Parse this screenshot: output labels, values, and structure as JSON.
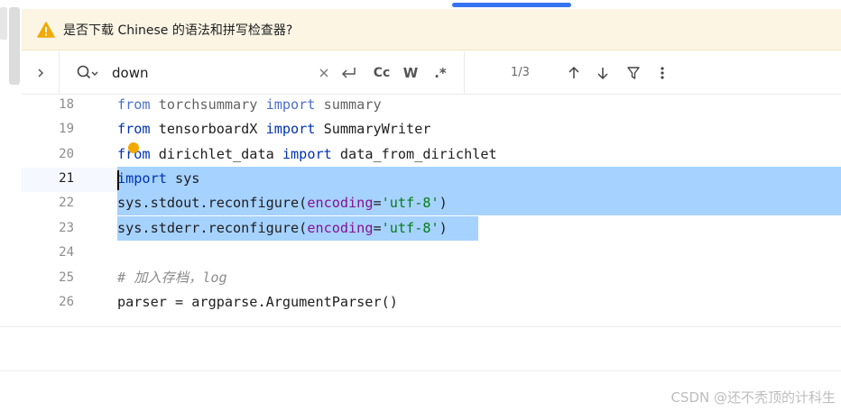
{
  "notice": {
    "icon": "warning-icon",
    "text": "是否下载 Chinese 的语法和拼写检查器?",
    "accent_color": "#f2a900"
  },
  "search": {
    "query": "down",
    "match_count": "1/3",
    "options": {
      "case_label": "Cc",
      "word_label": "W",
      "regex_label": ".*"
    }
  },
  "editor": {
    "lines": [
      {
        "number": "18",
        "text": "from torchsummary import summary"
      },
      {
        "number": "19",
        "text": "from tensorboardX import SummaryWriter"
      },
      {
        "number": "20",
        "text": "from dirichlet_data import data_from_dirichlet"
      },
      {
        "number": "21",
        "text": "import sys"
      },
      {
        "number": "22",
        "text": "sys.stdout.reconfigure(encoding='utf-8')"
      },
      {
        "number": "23",
        "text": "sys.stderr.reconfigure(encoding='utf-8')"
      },
      {
        "number": "24",
        "text": ""
      },
      {
        "number": "25",
        "text": "# 加入存档，log"
      },
      {
        "number": "26",
        "text": "parser = argparse.ArgumentParser()"
      }
    ],
    "current_line": "21",
    "selection_color": "#a6d2ff",
    "keyword_color": "#0033b3",
    "param_color": "#871094",
    "string_color": "#067d17"
  },
  "watermark": "CSDN @还不秃顶的计科生"
}
